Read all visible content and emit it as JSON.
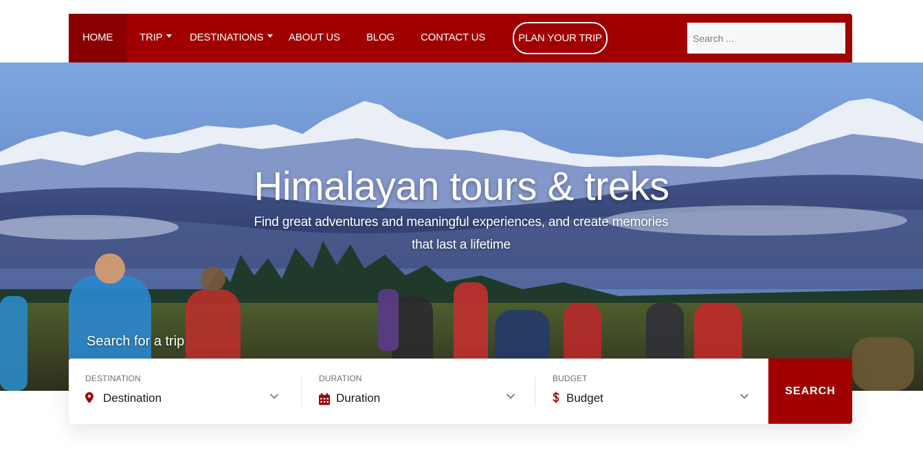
{
  "nav": {
    "items": [
      {
        "label": "HOME",
        "has_dropdown": false
      },
      {
        "label": "TRIP",
        "has_dropdown": true
      },
      {
        "label": "DESTINATIONS",
        "has_dropdown": true
      },
      {
        "label": "ABOUT US",
        "has_dropdown": false
      },
      {
        "label": "BLOG",
        "has_dropdown": false
      },
      {
        "label": "CONTACT US",
        "has_dropdown": false
      }
    ],
    "plan_button": "PLAN YOUR TRIP",
    "search_placeholder": "Search ..."
  },
  "hero": {
    "title": "Himalayan tours & treks",
    "subtitle_line1": "Find great adventures and meaningful experiences, and create memories",
    "subtitle_line2": "that last a lifetime",
    "search_label": "Search for a trip"
  },
  "trip_search": {
    "destination": {
      "label": "DESTINATION",
      "value": "Destination",
      "icon": "map-pin-icon"
    },
    "duration": {
      "label": "DURATION",
      "value": "Duration",
      "icon": "calendar-icon"
    },
    "budget": {
      "label": "BUDGET",
      "value": "Budget",
      "icon": "dollar-icon"
    },
    "button": "SEARCH"
  },
  "colors": {
    "brand": "#a00000",
    "brand_dark": "#8a0000",
    "text": "#1a1a1a",
    "label": "#6f6f6f"
  }
}
